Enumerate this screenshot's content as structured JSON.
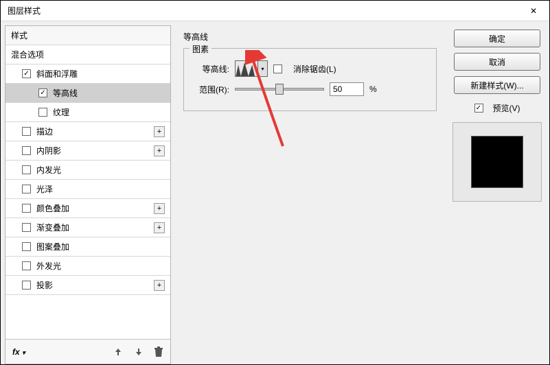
{
  "window": {
    "title": "图层样式",
    "close": "✕"
  },
  "sidebar": {
    "header": "样式",
    "items": [
      {
        "label": "混合选项",
        "checked": null,
        "plus": false,
        "indent": 0
      },
      {
        "label": "斜面和浮雕",
        "checked": true,
        "plus": false,
        "indent": 0
      },
      {
        "label": "等高线",
        "checked": true,
        "plus": false,
        "indent": 1,
        "selected": true
      },
      {
        "label": "纹理",
        "checked": false,
        "plus": false,
        "indent": 1
      },
      {
        "label": "描边",
        "checked": false,
        "plus": true,
        "indent": 0
      },
      {
        "label": "内阴影",
        "checked": false,
        "plus": true,
        "indent": 0
      },
      {
        "label": "内发光",
        "checked": false,
        "plus": false,
        "indent": 0
      },
      {
        "label": "光泽",
        "checked": false,
        "plus": false,
        "indent": 0
      },
      {
        "label": "颜色叠加",
        "checked": false,
        "plus": true,
        "indent": 0
      },
      {
        "label": "渐变叠加",
        "checked": false,
        "plus": true,
        "indent": 0
      },
      {
        "label": "图案叠加",
        "checked": false,
        "plus": false,
        "indent": 0
      },
      {
        "label": "外发光",
        "checked": false,
        "plus": false,
        "indent": 0
      },
      {
        "label": "投影",
        "checked": false,
        "plus": true,
        "indent": 0
      }
    ],
    "footer_fx": "fx"
  },
  "center": {
    "group_title": "等高线",
    "elements_title": "图素",
    "contour_label": "等高线:",
    "antialias_label": "消除锯齿(L)",
    "antialias_checked": false,
    "range_label": "范围(R):",
    "range_value": "50",
    "range_unit": "%"
  },
  "right": {
    "ok": "确定",
    "cancel": "取消",
    "new_style": "新建样式(W)...",
    "preview_label": "预览(V)",
    "preview_checked": true
  }
}
